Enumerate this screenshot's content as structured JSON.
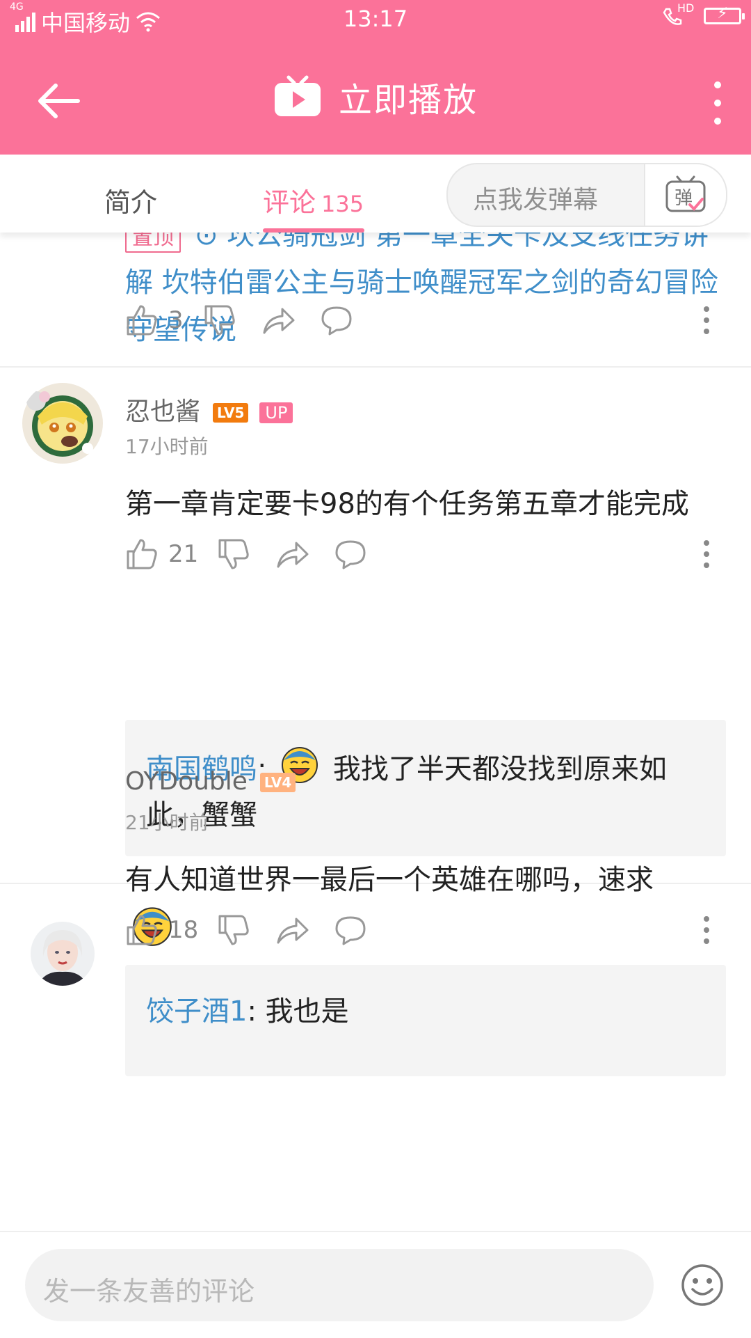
{
  "status": {
    "net": "4G",
    "carrier": "中国移动",
    "time": "13:17",
    "hd": "HD"
  },
  "appbar": {
    "title": "立即播放",
    "icons": [
      "back-arrow-icon",
      "tv-play-icon",
      "more-vertical-icon"
    ]
  },
  "tabs": {
    "intro": "简介",
    "comments": "评论",
    "comment_count": "135",
    "danmu_placeholder": "点我发弹幕",
    "danmu_button": "弹"
  },
  "pinned": {
    "tag": "置顶",
    "text": "⊙ 坎公骑冠剑 第一章全关卡及支线任务讲解 坎特伯雷公主与骑士唤醒冠军之剑的奇幻冒险 守望传说",
    "likes": "3"
  },
  "comments": [
    {
      "user": "忍也酱",
      "level": "LV5",
      "badge": "UP",
      "time": "17小时前",
      "text": "第一章肯定要卡98的有个任务第五章才能完成",
      "likes": "21",
      "reply": {
        "name": "南国鹤鸣",
        "sep": ":",
        "text": "我找了半天都没找到原来如此，蟹蟹"
      }
    },
    {
      "user": "OYDouble",
      "level": "LV4",
      "time": "21小时前",
      "text": "有人知道世界一最后一个英雄在哪吗，速求",
      "likes": "18",
      "reply": {
        "name": "饺子酒1",
        "sep": ":",
        "text": "我也是"
      }
    }
  ],
  "bottom": {
    "placeholder": "发一条友善的评论"
  },
  "colors": {
    "brand_pink": "#fb7299",
    "link_blue": "#3f8ec9",
    "lv5_orange": "#f27b0e",
    "lv4_orange": "#ffb27f"
  }
}
